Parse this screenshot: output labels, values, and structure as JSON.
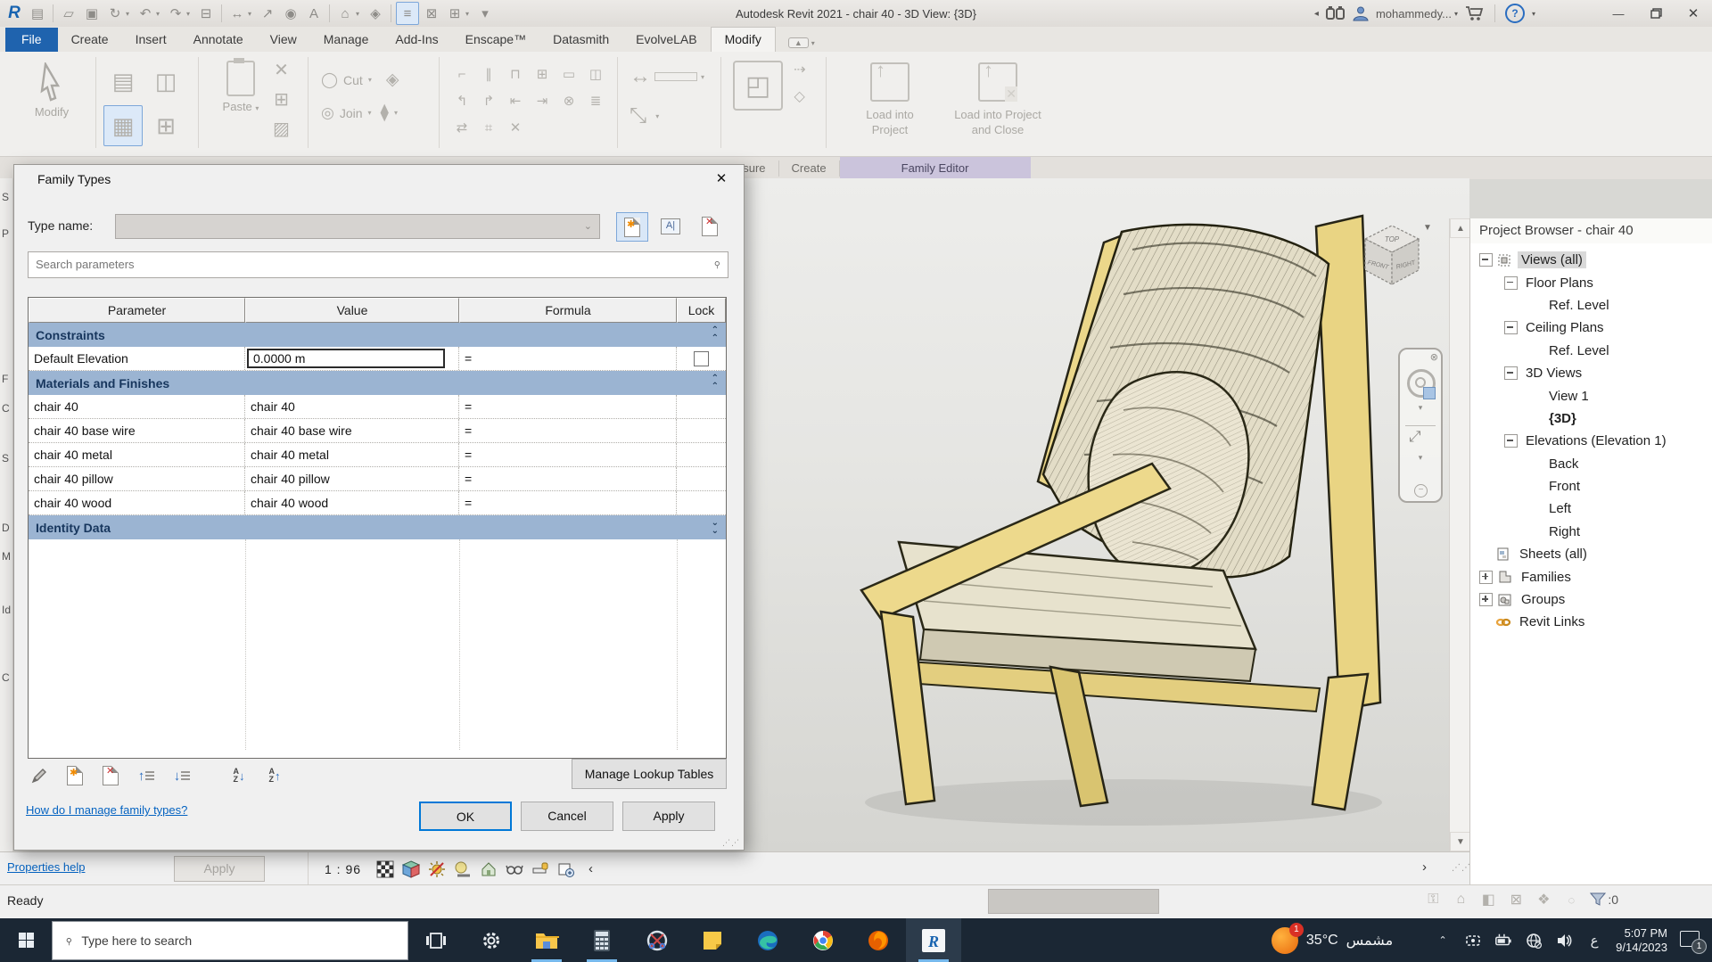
{
  "colors": {
    "accent_blue": "#2A6DC0",
    "file_tab_blue": "#1F63AE",
    "section_header_blue": "#9BB4D2",
    "family_editor_lavender": "#CBC4DC",
    "taskbar_dark": "#1B2734",
    "link_blue": "#0563C1",
    "focus_blue": "#0078D7"
  },
  "window": {
    "title": "Autodesk Revit 2021 - chair 40 - 3D View: {3D}",
    "user": "mohammedy...",
    "ready": "Ready"
  },
  "qat": [
    {
      "name": "revit-logo-icon",
      "glyph": "R"
    },
    {
      "name": "file-properties-icon",
      "glyph": "▤"
    },
    {
      "name": "open-icon",
      "glyph": "▱"
    },
    {
      "name": "save-icon",
      "glyph": "▣"
    },
    {
      "name": "sync-with-central-icon",
      "glyph": "↻",
      "caret": true
    },
    {
      "name": "undo-icon",
      "glyph": "↶",
      "caret": true
    },
    {
      "name": "redo-icon",
      "glyph": "↷",
      "caret": true
    },
    {
      "name": "print-icon",
      "glyph": "⊟"
    },
    {
      "name": "measure-icon",
      "glyph": "↔",
      "caret": true
    },
    {
      "name": "aligned-dimension-icon",
      "glyph": "↗"
    },
    {
      "name": "tag-by-category-icon",
      "glyph": "◉"
    },
    {
      "name": "text-icon",
      "glyph": "A"
    },
    {
      "name": "default-3d-view-icon",
      "glyph": "⌂",
      "caret": true
    },
    {
      "name": "section-icon",
      "glyph": "◈"
    },
    {
      "name": "thin-lines-icon",
      "glyph": "≡",
      "highlight": true
    },
    {
      "name": "close-inactive-views-icon",
      "glyph": "⊠"
    },
    {
      "name": "switch-windows-icon",
      "glyph": "⊞",
      "caret": true
    },
    {
      "name": "customize-quick-access-icon",
      "glyph": "▾"
    }
  ],
  "tabs": [
    {
      "label": "File",
      "kind": "file"
    },
    {
      "label": "Create"
    },
    {
      "label": "Insert"
    },
    {
      "label": "Annotate"
    },
    {
      "label": "View"
    },
    {
      "label": "Manage"
    },
    {
      "label": "Add-Ins"
    },
    {
      "label": "Enscape™"
    },
    {
      "label": "Datasmith"
    },
    {
      "label": "EvolveLAB"
    },
    {
      "label": "Modify",
      "active": true
    }
  ],
  "ribbon": {
    "modify_label": "Modify",
    "paste_label": "Paste",
    "cut_label": "Cut",
    "join_label": "Join",
    "load_into_project": "Load into Project",
    "load_into_project_and_close": "Load into Project and Close",
    "tool_glyphs": [
      "⌐",
      "∥",
      "⊓",
      "⊞",
      "▭",
      "◫",
      "↰",
      "↱",
      "⇤",
      "⇥",
      "⊗",
      "≣",
      "⇄",
      "⌗",
      "✕"
    ]
  },
  "panel_labels": {
    "measure": "asure",
    "create": "Create",
    "family_editor": "Family Editor"
  },
  "properties_strip": {
    "letters": [
      "S",
      "P",
      "F",
      "C",
      "S",
      "D",
      "M",
      "Id",
      "C"
    ],
    "tops": [
      14,
      55,
      218,
      251,
      307,
      385,
      417,
      477,
      553
    ]
  },
  "dialog": {
    "title": "Family Types",
    "close": "✕",
    "type_name_label": "Type name:",
    "type_icons": [
      "new-type-icon",
      "rename-type-icon",
      "delete-type-icon"
    ],
    "search_placeholder": "Search parameters",
    "columns": [
      "Parameter",
      "Value",
      "Formula",
      "Lock"
    ],
    "sections": [
      {
        "title": "Constraints",
        "chevron": "up",
        "rows": [
          {
            "param": "Default Elevation",
            "value": "0.0000 m",
            "formula": "=",
            "focused": true,
            "lock": true
          }
        ]
      },
      {
        "title": "Materials and Finishes",
        "chevron": "up",
        "rows": [
          {
            "param": "chair 40",
            "value": "chair 40",
            "formula": "="
          },
          {
            "param": "chair 40 base wire",
            "value": "chair 40 base wire",
            "formula": "="
          },
          {
            "param": "chair 40 metal",
            "value": "chair 40 metal",
            "formula": "="
          },
          {
            "param": "chair 40 pillow",
            "value": "chair 40 pillow",
            "formula": "="
          },
          {
            "param": "chair 40 wood",
            "value": "chair 40 wood",
            "formula": "="
          }
        ]
      },
      {
        "title": "Identity Data",
        "chevron": "down",
        "rows": []
      }
    ],
    "tools": [
      "edit-parameter-icon",
      "new-parameter-icon",
      "delete-parameter-icon",
      "move-up-icon",
      "move-down-icon",
      "sort-ascending-icon",
      "sort-descending-icon"
    ],
    "manage_lookup": "Manage Lookup Tables",
    "help_link": "How do I manage family types?",
    "ok": "OK",
    "cancel": "Cancel",
    "apply": "Apply"
  },
  "canvas": {
    "viewcube": {
      "top": "TOP",
      "front": "FRONT",
      "right": "RIGHT"
    }
  },
  "project_browser": {
    "title": "Project Browser - chair 40",
    "tree": [
      {
        "label": "Views (all)",
        "depth": 0,
        "expander": "minus",
        "icon": "views",
        "selected": true
      },
      {
        "label": "Floor Plans",
        "depth": 1,
        "expander": "minus"
      },
      {
        "label": "Ref. Level",
        "depth": 2
      },
      {
        "label": "Ceiling Plans",
        "depth": 1,
        "expander": "minus"
      },
      {
        "label": "Ref. Level",
        "depth": 2
      },
      {
        "label": "3D Views",
        "depth": 1,
        "expander": "minus"
      },
      {
        "label": "View 1",
        "depth": 2
      },
      {
        "label": "{3D}",
        "depth": 2,
        "bold": true
      },
      {
        "label": "Elevations (Elevation 1)",
        "depth": 1,
        "expander": "minus"
      },
      {
        "label": "Back",
        "depth": 2
      },
      {
        "label": "Front",
        "depth": 2
      },
      {
        "label": "Left",
        "depth": 2
      },
      {
        "label": "Right",
        "depth": 2
      },
      {
        "label": "Sheets (all)",
        "depth": 0,
        "icon": "sheets"
      },
      {
        "label": "Families",
        "depth": 0,
        "expander": "plus",
        "icon": "families"
      },
      {
        "label": "Groups",
        "depth": 0,
        "expander": "plus",
        "icon": "groups"
      },
      {
        "label": "Revit Links",
        "depth": 0,
        "icon": "revit-links"
      }
    ]
  },
  "bottom_bar": {
    "properties_help": "Properties help",
    "apply": "Apply",
    "scale": "1 : 96",
    "view_icons": [
      "detail-level-icon",
      "visual-style-icon",
      "sun-path-icon",
      "shadows-icon",
      "crop-view-icon",
      "reveal-hidden-icon",
      "temporary-view-properties-icon",
      "reveal-constraints-icon"
    ]
  },
  "status_bar": {
    "icons": [
      "worksets-icon",
      "editable-only-icon",
      "design-options-icon",
      "exclude-options-icon",
      "press-drag-icon"
    ],
    "filter_count": ":0"
  },
  "taskbar": {
    "search_placeholder": "Type here to search",
    "apps": [
      {
        "name": "task-view-icon"
      },
      {
        "name": "settings-icon"
      },
      {
        "name": "file-explorer-icon",
        "open": true
      },
      {
        "name": "calculator-icon",
        "open": true
      },
      {
        "name": "snipping-tool-icon"
      },
      {
        "name": "sticky-notes-icon"
      },
      {
        "name": "edge-icon"
      },
      {
        "name": "chrome-icon"
      },
      {
        "name": "firefox-icon"
      },
      {
        "name": "revit-icon",
        "open": true,
        "active": true
      }
    ],
    "weather_badge": "1",
    "weather_temp": "35°C",
    "weather_desc": "مشمس",
    "lang": "ع",
    "time": "5:07 PM",
    "date": "9/14/2023",
    "notif_badge": "1"
  }
}
